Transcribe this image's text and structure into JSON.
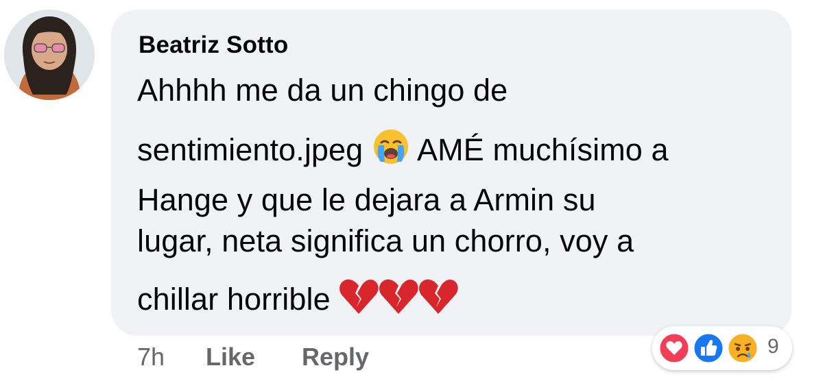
{
  "comment": {
    "author": "Beatriz Sotto",
    "text_lines": [
      "Ahhhh me da un chingo de",
      "sentimiento.jpeg",
      "AMÉ muchísimo a",
      "Hange y que le dejara a Armin su",
      "lugar, neta significa un chorro, voy a",
      "chillar horrible"
    ],
    "emojis": [
      "loudly-crying-face",
      "broken-heart",
      "broken-heart",
      "broken-heart"
    ],
    "time": "7h",
    "like_label": "Like",
    "reply_label": "Reply"
  },
  "reactions": {
    "icons": [
      "love-reaction-icon",
      "like-reaction-icon",
      "sad-reaction-icon"
    ],
    "count": "9",
    "colors": {
      "love": "#f33e58",
      "like": "#1877f2",
      "sad": "#f7b125"
    }
  }
}
